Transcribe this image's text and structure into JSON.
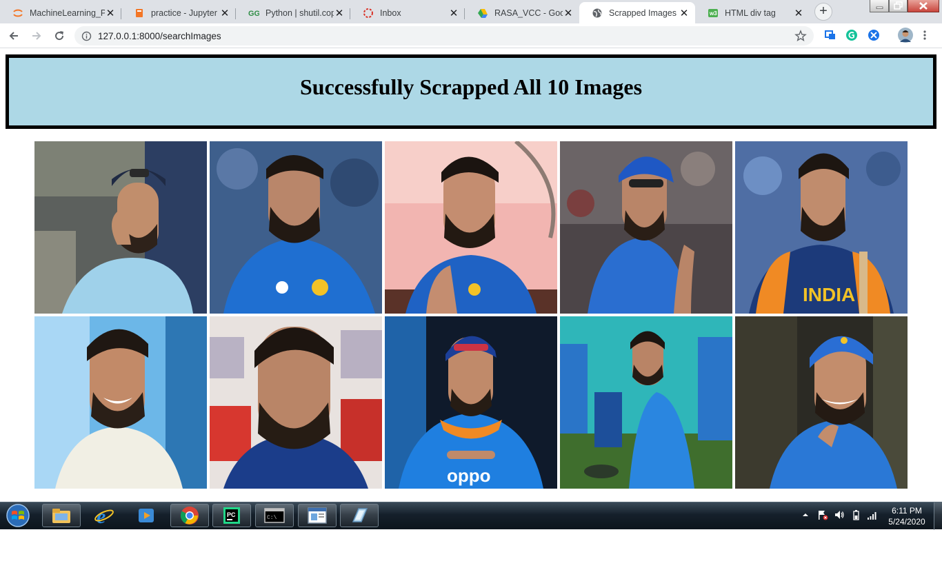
{
  "browser": {
    "tabs": [
      {
        "title": "MachineLearning_P",
        "icon": "jupyter-icon"
      },
      {
        "title": "practice - Jupyter N",
        "icon": "notebook-icon"
      },
      {
        "title": "Python | shutil.copy",
        "icon": "geeksforgeeks-icon"
      },
      {
        "title": "Inbox",
        "icon": "inbox-icon"
      },
      {
        "title": "RASA_VCC - Googl",
        "icon": "google-drive-icon"
      },
      {
        "title": "Scrapped Images",
        "icon": "globe-icon",
        "active": true
      },
      {
        "title": "HTML div tag",
        "icon": "w3schools-icon"
      }
    ],
    "address": "127.0.0.1:8000/searchImages"
  },
  "page": {
    "heading": "Successfully Scrapped All 10 Images",
    "banner_color": "#add8e6",
    "image_count": 10
  },
  "taskbar": {
    "time": "6:11 PM",
    "date": "5/24/2020"
  }
}
